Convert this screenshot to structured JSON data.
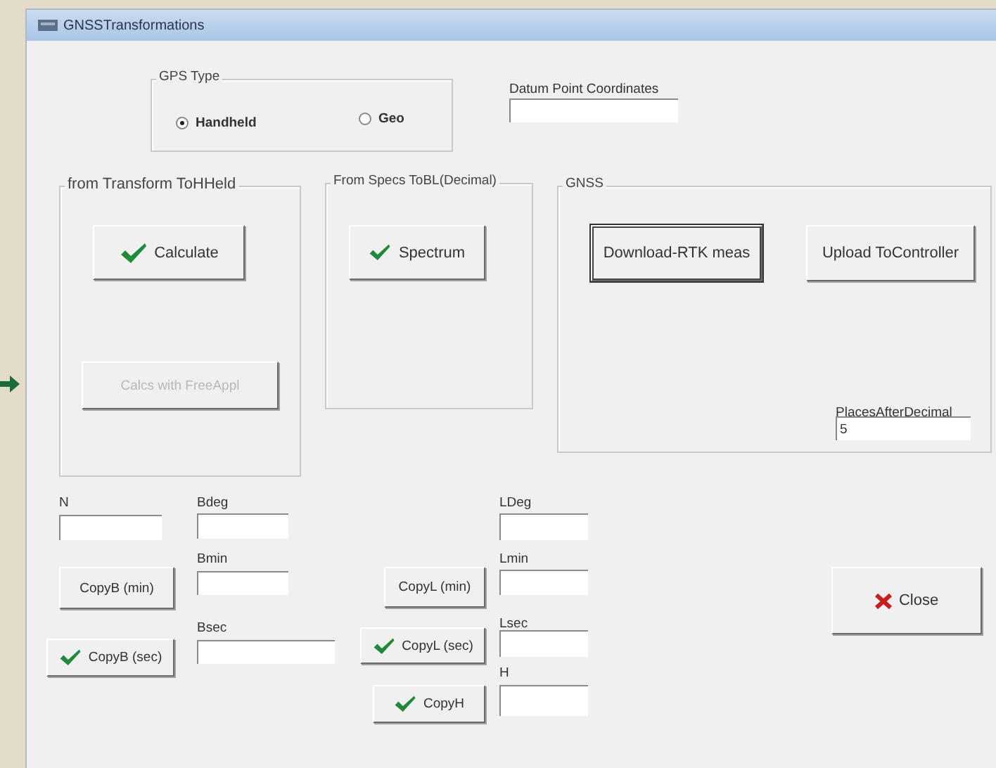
{
  "window": {
    "title": "GNSSTransformations"
  },
  "gps_type": {
    "label": "GPS Type",
    "options": [
      {
        "label": "Handheld",
        "selected": true
      },
      {
        "label": "Geo",
        "selected": false
      }
    ]
  },
  "datum": {
    "label": "Datum Point Coordinates"
  },
  "groups": [
    {
      "title": "from Transform ToHHeld",
      "buttons": [
        {
          "label": "Calculate",
          "kind": "check",
          "disabled": false,
          "default": false
        },
        {
          "label": "Calcs with FreeAppl",
          "kind": "plain",
          "disabled": true,
          "default": false
        }
      ]
    },
    {
      "title": "From Specs ToBL(Decimal)",
      "buttons": [
        {
          "label": "Spectrum",
          "kind": "check",
          "disabled": false,
          "default": false
        }
      ]
    },
    {
      "title": "GNSS",
      "buttons": [
        {
          "label": "Download-RTK meas",
          "kind": "plain",
          "disabled": false,
          "default": true
        },
        {
          "label": "Upload ToController",
          "kind": "plain",
          "disabled": false,
          "default": false
        }
      ],
      "field": {
        "label": "PlacesAfterDecimal",
        "value": "5"
      }
    }
  ],
  "fields": [
    {
      "label": "N"
    },
    {
      "label": "Bdeg"
    },
    {
      "label": "Bmin"
    },
    {
      "label": "Bsec"
    },
    {
      "label": "LDeg"
    },
    {
      "label": "Lmin"
    },
    {
      "label": "Lsec"
    },
    {
      "label": "H"
    }
  ],
  "buttons": [
    {
      "label": "CopyB (min)",
      "kind": "plain",
      "disabled": false,
      "default": false
    },
    {
      "label": "CopyB (sec)",
      "kind": "check",
      "disabled": false,
      "default": false
    },
    {
      "label": "CopyL (min)",
      "kind": "plain",
      "disabled": false,
      "default": false
    },
    {
      "label": "CopyL (sec)",
      "kind": "check",
      "disabled": false,
      "default": false
    },
    {
      "label": "CopyH",
      "kind": "check",
      "disabled": false,
      "default": false
    },
    {
      "label": "Close",
      "kind": "cross",
      "disabled": false,
      "default": false
    }
  ]
}
